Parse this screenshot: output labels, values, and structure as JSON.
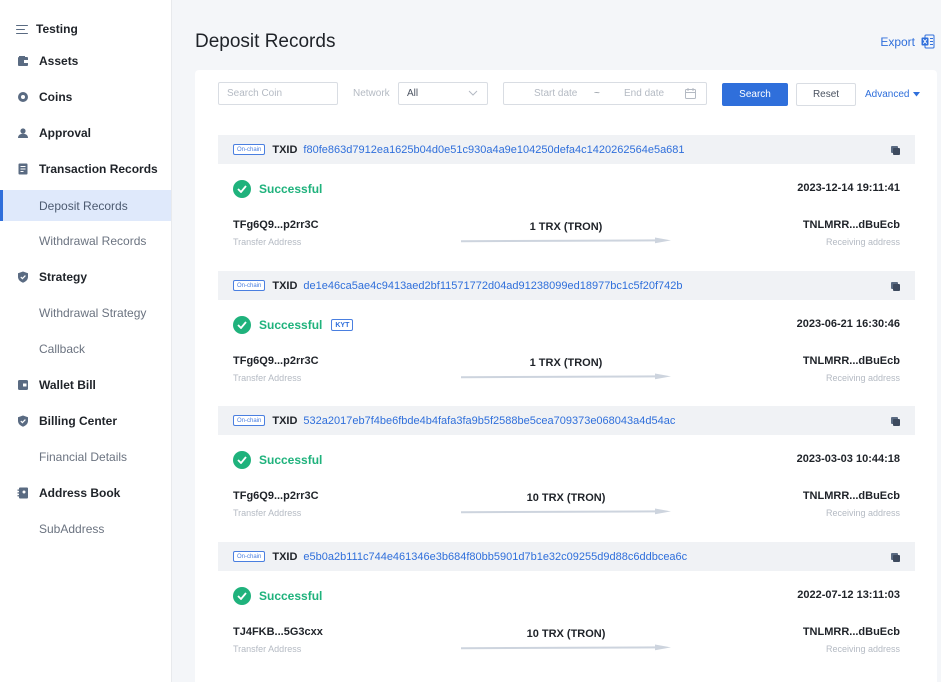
{
  "sidebar": {
    "header": "Testing",
    "items": [
      {
        "label": "Assets",
        "type": "parent",
        "icon": "wallet-icon"
      },
      {
        "label": "Coins",
        "type": "parent",
        "icon": "coin-icon"
      },
      {
        "label": "Approval",
        "type": "parent",
        "icon": "user-icon"
      },
      {
        "label": "Transaction Records",
        "type": "parent",
        "icon": "document-icon"
      },
      {
        "label": "Deposit Records",
        "type": "child",
        "active": true
      },
      {
        "label": "Withdrawal Records",
        "type": "child"
      },
      {
        "label": "Strategy",
        "type": "parent",
        "icon": "shield-icon"
      },
      {
        "label": "Withdrawal Strategy",
        "type": "child"
      },
      {
        "label": "Callback",
        "type": "child"
      },
      {
        "label": "Wallet Bill",
        "type": "parent",
        "icon": "bill-icon"
      },
      {
        "label": "Billing Center",
        "type": "parent",
        "icon": "shield-check-icon"
      },
      {
        "label": "Financial Details",
        "type": "child"
      },
      {
        "label": "Address Book",
        "type": "parent",
        "icon": "book-icon"
      },
      {
        "label": "SubAddress",
        "type": "child"
      }
    ]
  },
  "page": {
    "title": "Deposit Records",
    "export_label": "Export"
  },
  "filters": {
    "search_coin_placeholder": "Search Coin",
    "network_label": "Network",
    "network_value": "All",
    "start_date_placeholder": "Start date",
    "date_separator": "~",
    "end_date_placeholder": "End date",
    "search_button": "Search",
    "reset_button": "Reset",
    "advanced_label": "Advanced"
  },
  "records": [
    {
      "badge": "On-chain",
      "txid_label": "TXID",
      "txid": "f80fe863d7912ea1625b04d0e51c930a4a9e104250defa4c1420262564e5a681",
      "status": "Successful",
      "kyt": "",
      "time": "2023-12-14 19:11:41",
      "from": "TFg6Q9...p2rr3C",
      "from_label": "Transfer Address",
      "amount": "1 TRX (TRON)",
      "to": "TNLMRR...dBuEcb",
      "to_label": "Receiving address"
    },
    {
      "badge": "On-chain",
      "txid_label": "TXID",
      "txid": "de1e46ca5ae4c9413aed2bf11571772d04ad91238099ed18977bc1c5f20f742b",
      "status": "Successful",
      "kyt": "KYT",
      "time": "2023-06-21 16:30:46",
      "from": "TFg6Q9...p2rr3C",
      "from_label": "Transfer Address",
      "amount": "1 TRX (TRON)",
      "to": "TNLMRR...dBuEcb",
      "to_label": "Receiving address"
    },
    {
      "badge": "On-chain",
      "txid_label": "TXID",
      "txid": "532a2017eb7f4be6fbde4b4fafa3fa9b5f2588be5cea709373e068043a4d54ac",
      "status": "Successful",
      "kyt": "",
      "time": "2023-03-03 10:44:18",
      "from": "TFg6Q9...p2rr3C",
      "from_label": "Transfer Address",
      "amount": "10 TRX (TRON)",
      "to": "TNLMRR...dBuEcb",
      "to_label": "Receiving address"
    },
    {
      "badge": "On-chain",
      "txid_label": "TXID",
      "txid": "e5b0a2b111c744e461346e3b684f80bb5901d7b1e32c09255d9d88c6ddbcea6c",
      "status": "Successful",
      "kyt": "",
      "time": "2022-07-12 13:11:03",
      "from": "TJ4FKB...5G3cxx",
      "from_label": "Transfer Address",
      "amount": "10 TRX (TRON)",
      "to": "TNLMRR...dBuEcb",
      "to_label": "Receiving address"
    }
  ],
  "colors": {
    "accent": "#2f6fdb",
    "success": "#1fb27c",
    "active_bg": "#dfe9fb"
  }
}
